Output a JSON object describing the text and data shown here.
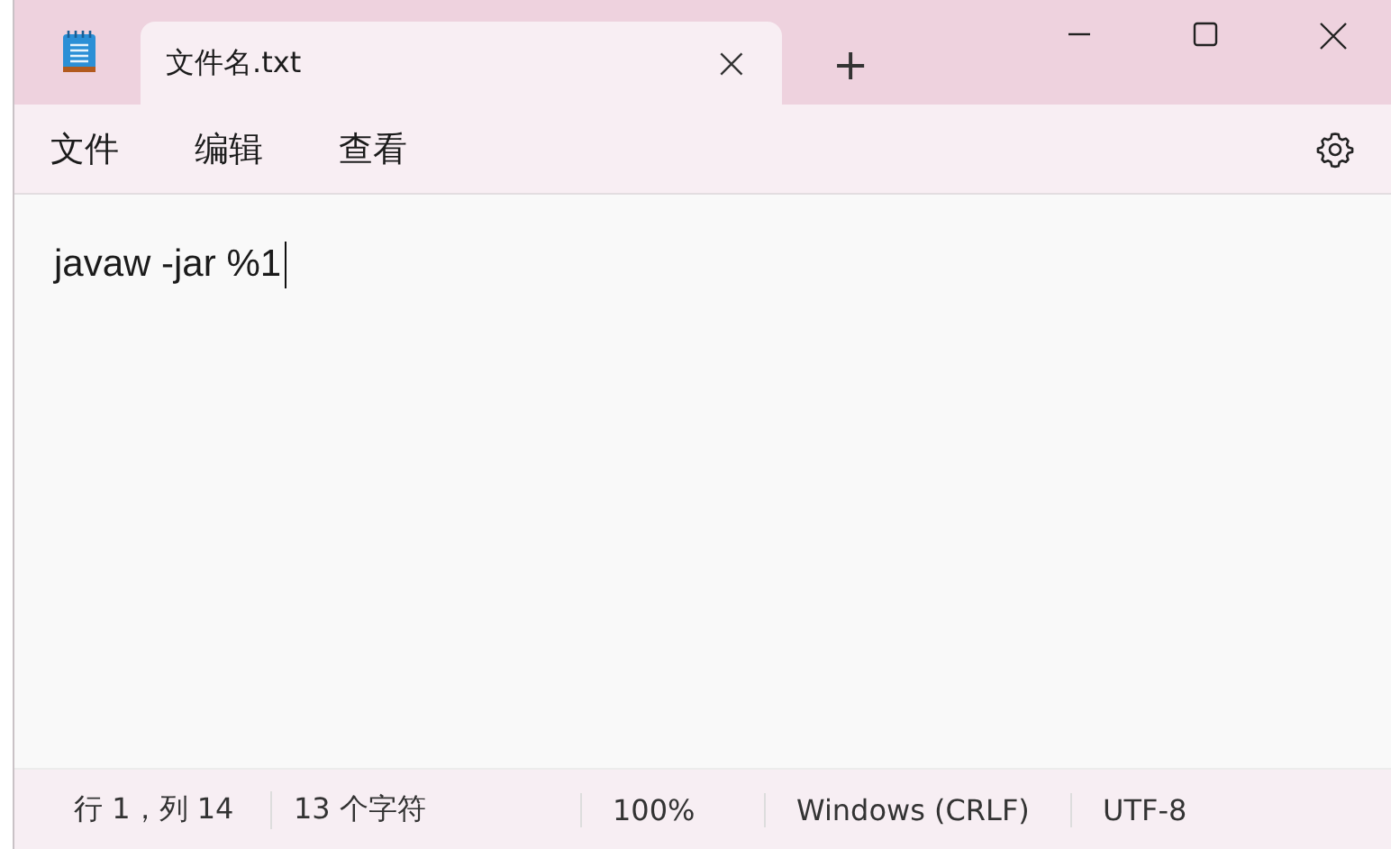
{
  "tabs": [
    {
      "label": "文件名.txt",
      "close": "×",
      "selected": true
    }
  ],
  "new_tab": "+",
  "menu": [
    {
      "label": "文件"
    },
    {
      "label": "编辑"
    },
    {
      "label": "查看"
    }
  ],
  "editor": {
    "text": "javaw -jar %1"
  },
  "status_bar": [
    "行 1，列 14",
    "13 个字符",
    "100%",
    "Windows (CRLF)",
    "UTF-8"
  ]
}
